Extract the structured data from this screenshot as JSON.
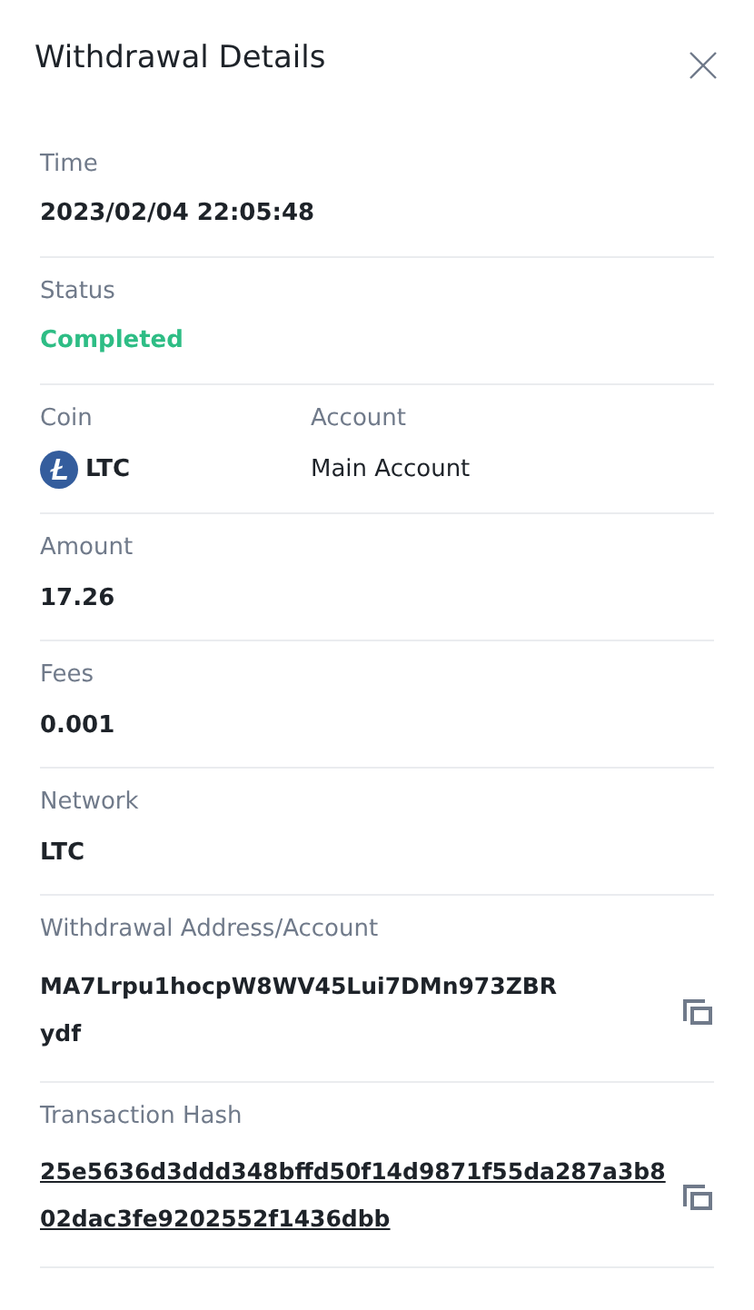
{
  "title": "Withdrawal Details",
  "fields": [
    {
      "kind": "text",
      "label": "Time",
      "value": "2023/02/04 22:05:48"
    },
    {
      "kind": "status",
      "label": "Status",
      "value": "Completed"
    },
    {
      "kind": "coin_account",
      "label": "Coin",
      "value": "LTC",
      "label_2": "Account",
      "value_2": "Main Account"
    },
    {
      "kind": "text",
      "label": "Amount",
      "value": "17.26"
    },
    {
      "kind": "text",
      "label": "Fees",
      "value": "0.001"
    },
    {
      "kind": "text",
      "label": "Network",
      "value": "LTC"
    },
    {
      "kind": "copyable",
      "label": "Withdrawal Address/Account",
      "value_lines": [
        "MA7Lrpu1hocpW8WV45Lui7DMn973ZBR",
        "ydf"
      ]
    },
    {
      "kind": "link",
      "label": "Transaction Hash",
      "value_lines": [
        "25e5636d3ddd348bffd50f14d9871f55da287a3b8",
        "02dac3fe9202552f1436dbb"
      ]
    }
  ]
}
